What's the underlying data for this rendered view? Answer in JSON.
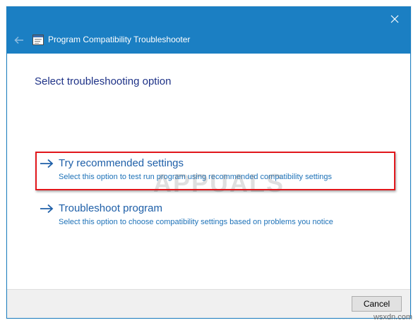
{
  "window": {
    "title": "Program Compatibility Troubleshooter",
    "accent_color": "#1b7fc3"
  },
  "icons": {
    "close": "close-icon",
    "back": "back-arrow-icon",
    "app": "troubleshooter-app-icon",
    "option_arrow": "right-arrow-icon"
  },
  "main": {
    "heading": "Select troubleshooting option",
    "options": [
      {
        "title": "Try recommended settings",
        "description": "Select this option to test run program using recommended compatibility settings",
        "highlighted": true
      },
      {
        "title": "Troubleshoot program",
        "description": "Select this option to choose compatibility settings based on problems you notice",
        "highlighted": false
      }
    ]
  },
  "footer": {
    "cancel_label": "Cancel"
  },
  "watermark": {
    "text": "APPUALS"
  },
  "site_mark": "wsxdn.com",
  "colors": {
    "heading": "#1e3287",
    "link": "#1e5fa8",
    "highlight": "#e2171c"
  }
}
